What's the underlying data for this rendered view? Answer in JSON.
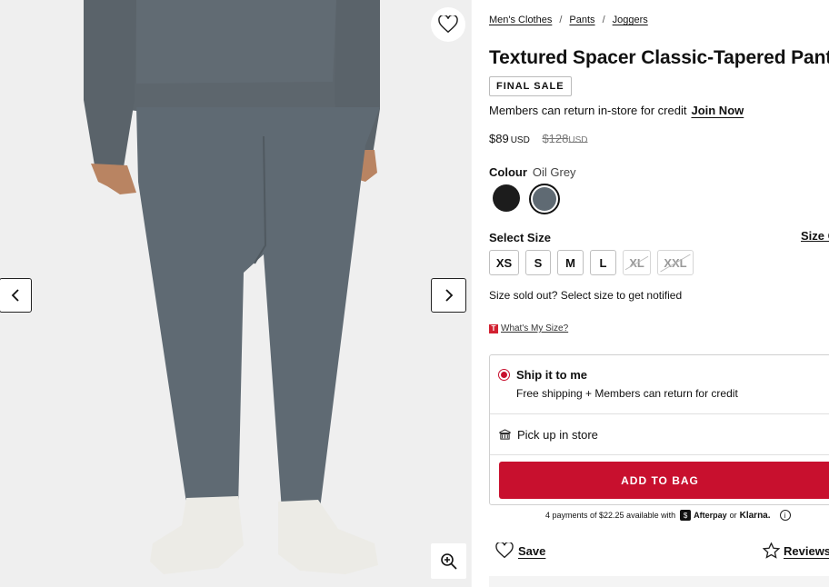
{
  "breadcrumb": [
    "Men's Clothes",
    "Pants",
    "Joggers"
  ],
  "breadcrumb_separator": "/",
  "product": {
    "title": "Textured Spacer Classic-Tapered Pant",
    "badge": "FINAL SALE",
    "members_text": "Members can return in-store for credit",
    "join_label": "Join Now",
    "price": "$89",
    "currency": "USD",
    "old_price": "$128",
    "old_currency": "USD"
  },
  "colour": {
    "label": "Colour",
    "selected_name": "Oil Grey",
    "swatches": [
      {
        "name": "black",
        "hex": "#1c1c1c",
        "selected": false
      },
      {
        "name": "Oil Grey",
        "hex": "#5f6a73",
        "selected": true
      }
    ]
  },
  "size": {
    "label": "Select Size",
    "guide_label": "Size Guide",
    "options": [
      {
        "label": "XS",
        "available": true
      },
      {
        "label": "S",
        "available": true
      },
      {
        "label": "M",
        "available": true
      },
      {
        "label": "L",
        "available": true
      },
      {
        "label": "XL",
        "available": false
      },
      {
        "label": "XXL",
        "available": false
      }
    ],
    "soldout_text": "Size sold out? Select size to get notified",
    "whats_my_size": "What's My Size?"
  },
  "shipping": {
    "ship_label": "Ship it to me",
    "ship_sub": "Free shipping + Members can return for credit",
    "pickup_label": "Pick up in store"
  },
  "cta": {
    "add_to_bag": "ADD TO BAG"
  },
  "payments": {
    "prefix": "4 payments of $22.25 available with",
    "afterpay": "Afterpay",
    "or": "or",
    "klarna": "Klarna."
  },
  "actions": {
    "save": "Save",
    "reviews": "Reviews"
  },
  "colors": {
    "brand_red": "#c8102e",
    "pant_grey": "#5f6a73",
    "bg_image": "#efefef"
  }
}
